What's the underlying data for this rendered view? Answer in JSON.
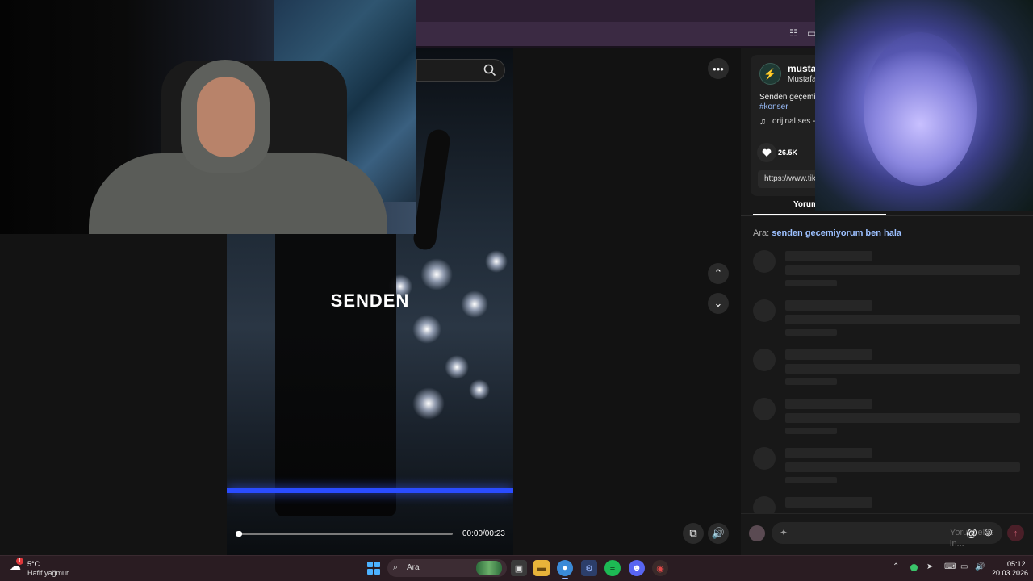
{
  "video": {
    "caption": "SENDEN",
    "time": "00:00/00:23",
    "progress": 0.0
  },
  "author": {
    "name": "musta",
    "handle": "Mustafa",
    "avatar_icon": "lightning-icon",
    "description": "Senden geçemiy",
    "hashtag": "#konser",
    "music": "orijinal ses -"
  },
  "stats": {
    "likes": "26.5K"
  },
  "link": "https://www.tik",
  "comments": {
    "tab_label": "Yorum",
    "search_label": "Ara:",
    "search_query": "senden gecemiyorum ben hala",
    "input_placeholder": "Yorum ekle in..."
  },
  "taskbar": {
    "weather_temp": "5°C",
    "weather_cond": "Hafif yağmur",
    "weather_badge": "1",
    "search_placeholder": "Ara",
    "time": "05:12",
    "date": "20.03.2026"
  },
  "colors": {
    "accent_link": "#9cc0ff",
    "send_button": "#4a1f28",
    "taskbar": "#2a1c22"
  }
}
